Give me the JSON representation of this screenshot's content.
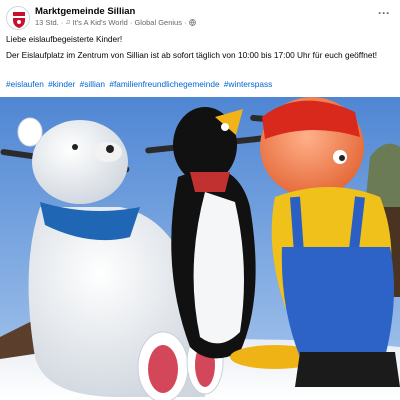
{
  "post": {
    "author": "Marktgemeinde Sillian",
    "time": "13 Std.",
    "separator": "·",
    "music_icon": "music-note-icon",
    "music": "It's A Kid's World · Global Genius",
    "middot": "·",
    "audience_icon": "globe-icon",
    "more_icon": "more-options-icon",
    "more_label": "···",
    "greeting": "Liebe eislaufbegeisterte Kinder!",
    "body": "Der Eislaufplatz im Zentrum von Sillian ist ab sofort täglich von 10:00 bis 17:00 Uhr für euch geöffnet!",
    "hashtags": [
      "#eislaufen",
      "#kinder",
      "#sillian",
      "#familienfreundlichegemeinde",
      "#winterspass"
    ]
  },
  "colors": {
    "link": "#0064d1",
    "meta": "#65676b",
    "sky": "#6f9fd8"
  },
  "photo_subjects": [
    "polar-bear-skating-aid",
    "penguin-skating-aid",
    "boy-figure-skating-aid"
  ]
}
